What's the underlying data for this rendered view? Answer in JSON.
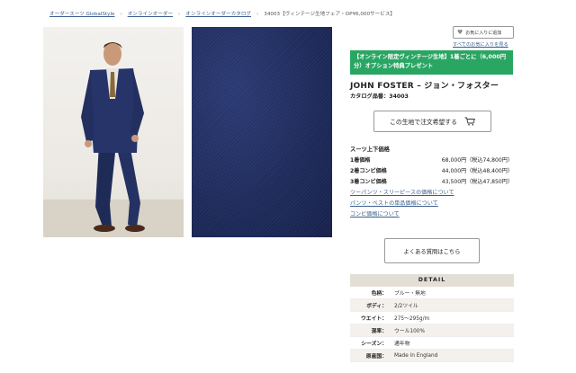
{
  "breadcrumb": {
    "items": [
      "オーダースーツ GlobalStyle",
      "オンラインオーダー",
      "オンラインオーダーカタログ"
    ],
    "current": "34003【ヴィンテージ生地フェア・OP¥6,000サービス】"
  },
  "favorite": {
    "button_label": "お気に入りに追加",
    "list_link": "すべてのお気に入りを見る"
  },
  "promo": {
    "text": "【オンライン限定ヴィンテージ生地】1着ごとに（6,000円分）オプション特典プレゼント"
  },
  "product": {
    "brand": "JOHN FOSTER – ジョン・フォスター",
    "catalog_number": "カタログ品番：34003"
  },
  "order_button": "この生地で注文希望する",
  "pricing": {
    "title": "スーツ上下価格",
    "rows": [
      {
        "label": "1着価格",
        "price": "68,000円（税込74,800円）"
      },
      {
        "label": "2着コンビ価格",
        "price": "44,000円（税込48,400円）"
      },
      {
        "label": "3着コンビ価格",
        "price": "43,500円（税込47,850円）"
      }
    ],
    "links": [
      "ツーパンツ・スリーピースの価格について",
      "パンツ・ベストの単品価格について",
      "コンビ価格について"
    ]
  },
  "faq_button": "よくある質問はこちら",
  "detail": {
    "title": "DETAIL",
    "rows": [
      {
        "key": "色柄：",
        "value": "ブルー・無地"
      },
      {
        "key": "ボディ：",
        "value": "2/2ツイル"
      },
      {
        "key": "ウエイト：",
        "value": "275～295g/m"
      },
      {
        "key": "混率：",
        "value": "ウール100%"
      },
      {
        "key": "シーズン：",
        "value": "通年物"
      },
      {
        "key": "原産国：",
        "value": "Made in England"
      }
    ]
  },
  "colors": {
    "promo_bg": "#2aa663",
    "link": "#3a5f8f",
    "fabric": "#1d2a5a"
  }
}
